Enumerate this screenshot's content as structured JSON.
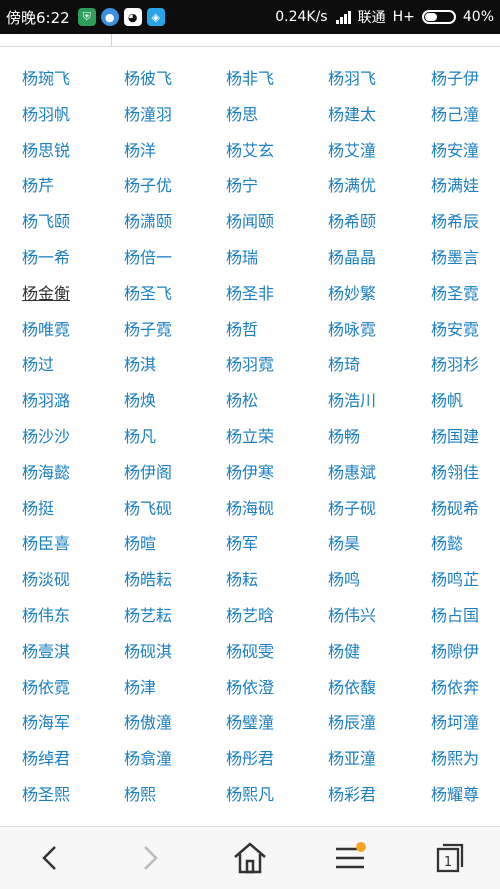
{
  "status_bar": {
    "time": "傍晚6:22",
    "speed": "0.24K/s",
    "carrier": "联通",
    "network": "H+",
    "battery": "40%"
  },
  "names": [
    [
      "杨琬飞",
      "杨彼飞",
      "杨非飞",
      "杨羽飞",
      "杨子伊"
    ],
    [
      "杨羽帆",
      "杨潼羽",
      "杨思",
      "杨建太",
      "杨己潼"
    ],
    [
      "杨思锐",
      "杨洋",
      "杨艾玄",
      "杨艾潼",
      "杨安潼"
    ],
    [
      "杨芹",
      "杨子优",
      "杨宁",
      "杨满优",
      "杨满娃"
    ],
    [
      "杨飞颐",
      "杨潇颐",
      "杨闻颐",
      "杨希颐",
      "杨希辰"
    ],
    [
      "杨一希",
      "杨倍一",
      "杨瑞",
      "杨晶晶",
      "杨墨言"
    ],
    [
      "杨金衡",
      "杨圣飞",
      "杨圣非",
      "杨妙繁",
      "杨圣霓"
    ],
    [
      "杨唯霓",
      "杨子霓",
      "杨哲",
      "杨咏霓",
      "杨安霓"
    ],
    [
      "杨过",
      "杨淇",
      "杨羽霓",
      "杨琦",
      "杨羽杉"
    ],
    [
      "杨羽潞",
      "杨焕",
      "杨松",
      "杨浩川",
      "杨帆"
    ],
    [
      "杨沙沙",
      "杨凡",
      "杨立荣",
      "杨畅",
      "杨国建"
    ],
    [
      "杨海懿",
      "杨伊阁",
      "杨伊寒",
      "杨惠斌",
      "杨翎佳"
    ],
    [
      "杨挺",
      "杨飞砚",
      "杨海砚",
      "杨子砚",
      "杨砚希"
    ],
    [
      "杨臣喜",
      "杨暄",
      "杨军",
      "杨昊",
      "杨懿"
    ],
    [
      "杨淡砚",
      "杨皓耘",
      "杨耘",
      "杨鸣",
      "杨鸣芷"
    ],
    [
      "杨伟东",
      "杨艺耘",
      "杨艺晗",
      "杨伟兴",
      "杨占国"
    ],
    [
      "杨壹淇",
      "杨砚淇",
      "杨砚雯",
      "杨健",
      "杨隙伊"
    ],
    [
      "杨依霓",
      "杨津",
      "杨依澄",
      "杨依馥",
      "杨依奔"
    ],
    [
      "杨海军",
      "杨傲潼",
      "杨璧潼",
      "杨辰潼",
      "杨坷潼"
    ],
    [
      "杨绰君",
      "杨翕潼",
      "杨彤君",
      "杨亚潼",
      "杨熙为"
    ],
    [
      "杨圣熙",
      "杨熙",
      "杨熙凡",
      "杨彩君",
      "杨耀尊"
    ]
  ],
  "visited_name": "杨金衡",
  "colors": {
    "link": "#1b7fc2",
    "visited": "#333333",
    "badge": "#f5a623"
  },
  "bottom_nav": [
    "back-icon",
    "forward-icon",
    "home-icon",
    "menu-icon",
    "tabs-icon"
  ]
}
